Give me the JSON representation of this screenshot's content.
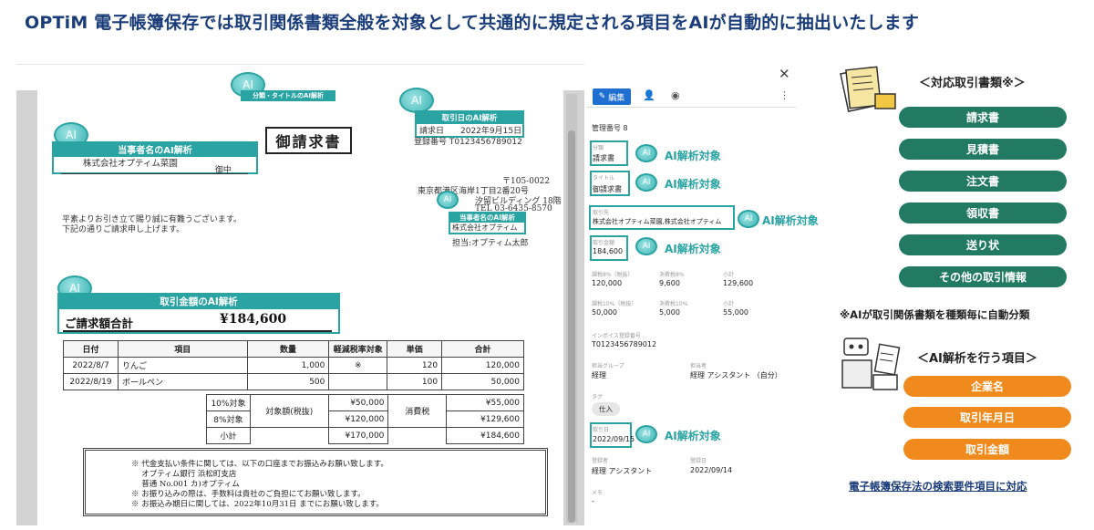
{
  "headline": "OPTiM 電子帳簿保存では取引関係書類全般を対象として共通的に規定される項目をAIが自動的に抽出いたします",
  "document": {
    "title": "御請求書",
    "ai_title_label": "分類・タイトルのAI解析",
    "ai_party_label": "当事者名のAI解析",
    "ai_date_label": "取引日のAI解析",
    "ai_amount_label": "取引金額のAI解析",
    "brain_text": "AI",
    "customer": "株式会社オプティム菜園",
    "customer_suffix": "御中",
    "date_line": "請求日　　2022年9月15日",
    "number_line": "登録番号 T0123456789012",
    "postal": "〒105-0022",
    "address1": "東京都港区海岸1丁目2番20号",
    "address2": "汐留ビルディング 18階",
    "phone": "TEL 03-6435-8570",
    "issuer": "株式会社オプティム",
    "contact": "担当:オプティム太郎",
    "greeting1": "平素よりお引き立て賜り誠に有難うございます。",
    "greeting2": "下記の通りご請求申し上げます。",
    "total_label": "ご請求額合計",
    "total_value": "¥184,600",
    "items_headers": [
      "日付",
      "項目",
      "数量",
      "軽減税率対象",
      "単価",
      "合計"
    ],
    "items": [
      {
        "date": "2022/8/7",
        "item": "りんご",
        "qty": "1,000",
        "reduced": "※",
        "price": "120",
        "total": "120,000"
      },
      {
        "date": "2022/8/19",
        "item": "ボールペン",
        "qty": "500",
        "reduced": "",
        "price": "100",
        "total": "50,000"
      }
    ],
    "summary": {
      "r10": "10%対象",
      "r8": "8%対象",
      "subtotal": "小計",
      "taxable_label": "対象額(税抜)",
      "tax_label": "消費税",
      "taxable10": "¥50,000",
      "taxable8": "¥120,000",
      "taxable_sub": "¥170,000",
      "tax10": "¥55,000",
      "tax8": "¥129,600",
      "tax_sub": "¥184,600"
    },
    "remarks": [
      "※ 代金支払い条件に関しては、以下の口座までお振込みお願い致します。",
      "　 オプティム銀行 浜松町支店",
      "　 普通 No.001 カ)オプティム",
      "※ お振り込みの際は、手数料は貴社のご負担にてお願い致します。",
      "※ お振込み期日に関しては、2022年10月31日 までにお願い致します。"
    ]
  },
  "panel": {
    "edit_label": "編集",
    "management_no": "管理番号 8",
    "fields": {
      "type_label": "分類",
      "type_value": "請求書",
      "title_label": "タイトル",
      "title_value": "御請求書",
      "party_label": "取引先",
      "party_value": "株式会社オプティム菜園,株式会社オプティム",
      "amount_label": "取引金額",
      "amount_value": "184,600",
      "t8_label": "課税8%（税抜）",
      "t8_value": "120,000",
      "tax8_label": "消費税8%",
      "tax8_value": "9,600",
      "sub8_label": "小計",
      "sub8_value": "129,600",
      "t10_label": "課税10%（税抜）",
      "t10_value": "50,000",
      "tax10_label": "消費税10%",
      "tax10_value": "5,000",
      "sub10_label": "小計",
      "sub10_value": "55,000",
      "invoice_label": "インボイス登録番号",
      "invoice_value": "T0123456789012",
      "group_label": "担当グループ",
      "group_value": "経理",
      "person_label": "担当者",
      "person_value": "経理 アシスタント （自分）",
      "tag_label": "タグ",
      "tag_value": "仕入",
      "date_label": "取引日",
      "date_value": "2022/09/15",
      "reg_label": "登録者",
      "reg_value": "経理 アシスタント",
      "regdate_label": "登録日",
      "regdate_value": "2022/09/14",
      "memo_label": "メモ",
      "memo_value": "-"
    },
    "ai_target": "AI解析対象"
  },
  "side": {
    "doc_types_heading": "＜対応取引書類※＞",
    "doc_types": [
      "請求書",
      "見積書",
      "注文書",
      "領収書",
      "送り状",
      "その他の取引情報"
    ],
    "note": "※AIが取引関係書類を種類毎に自動分類",
    "fields_heading": "＜AI解析を行う項目＞",
    "fields": [
      "企業名",
      "取引年月日",
      "取引金額"
    ],
    "footer": "電子帳簿保存法の検索要件項目に対応"
  }
}
